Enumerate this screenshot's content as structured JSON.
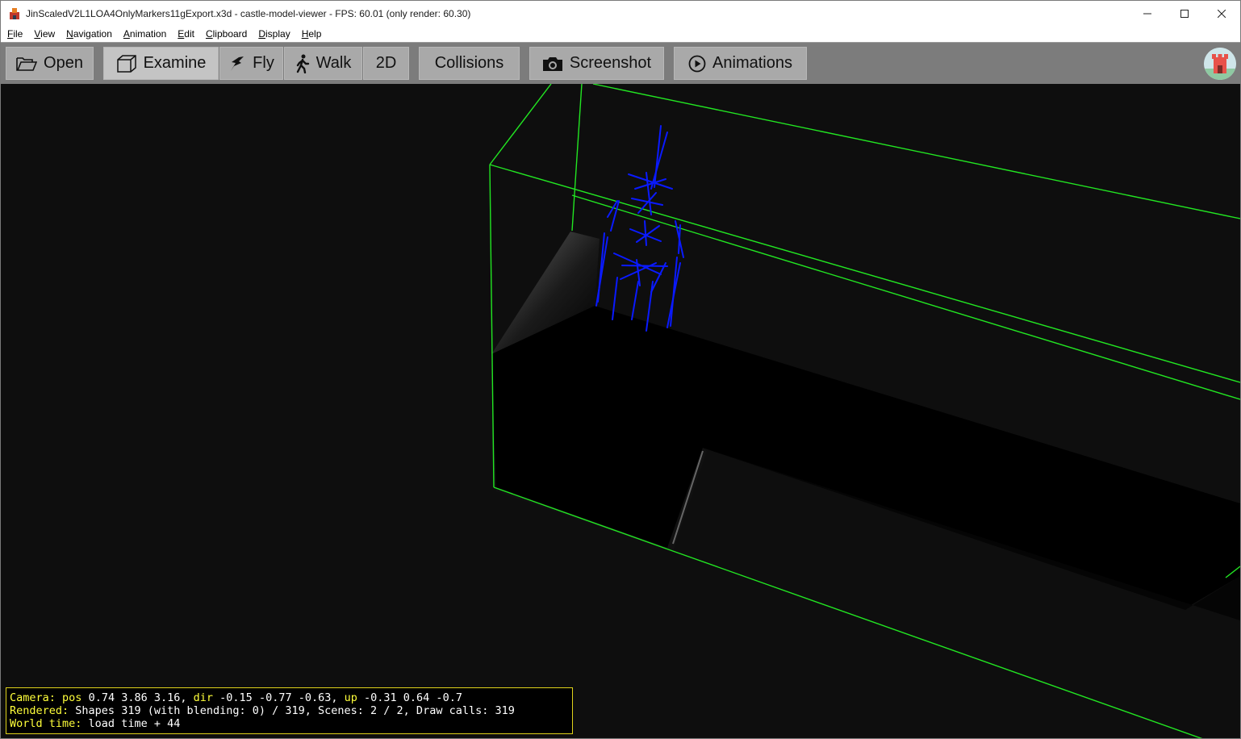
{
  "window": {
    "title": "JinScaledV2L1LOA4OnlyMarkers11gExport.x3d - castle-model-viewer - FPS: 60.01 (only render: 60.30)"
  },
  "menu": [
    {
      "label": "File",
      "ul": "F",
      "rest": "ile"
    },
    {
      "label": "View",
      "ul": "V",
      "rest": "iew"
    },
    {
      "label": "Navigation",
      "ul": "N",
      "rest": "avigation"
    },
    {
      "label": "Animation",
      "ul": "A",
      "rest": "nimation"
    },
    {
      "label": "Edit",
      "ul": "E",
      "rest": "dit"
    },
    {
      "label": "Clipboard",
      "ul": "C",
      "rest": "lipboard"
    },
    {
      "label": "Display",
      "ul": "D",
      "rest": "isplay"
    },
    {
      "label": "Help",
      "ul": "H",
      "rest": "elp"
    }
  ],
  "toolbar": {
    "open": "Open",
    "examine": "Examine",
    "fly": "Fly",
    "walk": "Walk",
    "two_d": "2D",
    "collisions": "Collisions",
    "screenshot": "Screenshot",
    "animations": "Animations",
    "active_mode": "Examine"
  },
  "hud": {
    "camera_label": "Camera:",
    "pos_label": "pos",
    "pos_value": "0.74 3.86 3.16,",
    "dir_label": "dir",
    "dir_value": "-0.15 -0.77 -0.63,",
    "up_label": "up",
    "up_value": "-0.31 0.64 -0.7",
    "rendered_label": "Rendered:",
    "rendered_value": "Shapes 319 (with blending: 0) / 319, Scenes: 2 / 2, Draw calls: 319",
    "world_label": "World time:",
    "world_value": "load time + 44"
  },
  "colors": {
    "bbox": "#22e622",
    "markers": "#0a1aff",
    "hud_key": "#ffff3a",
    "toolbar_bg": "#7c7c7c",
    "viewport_bg": "#0e0e0e"
  }
}
